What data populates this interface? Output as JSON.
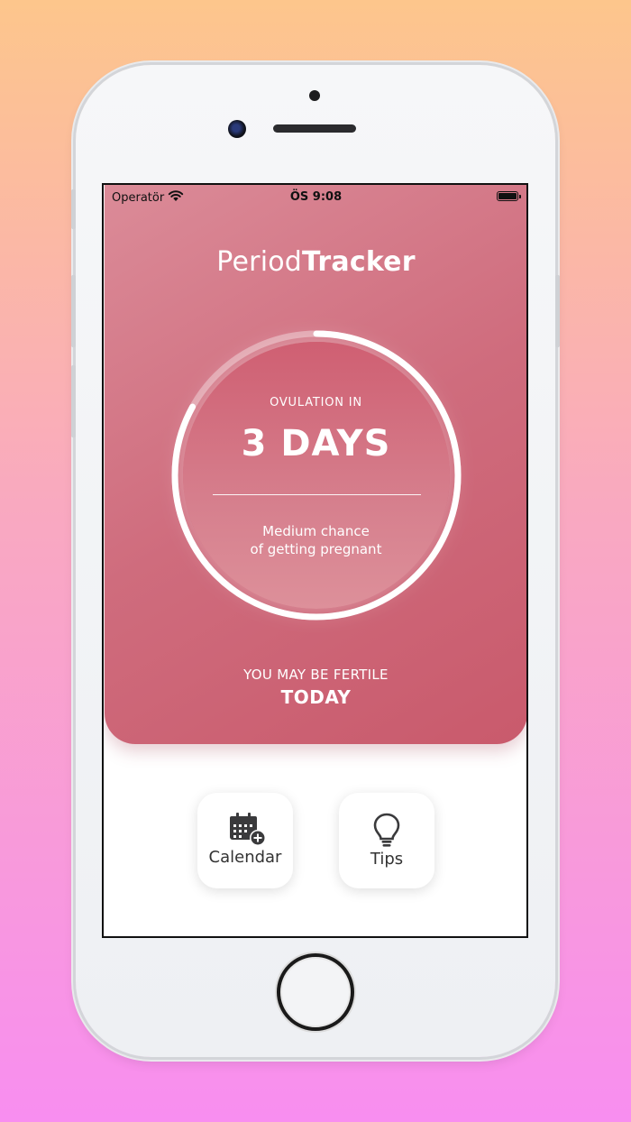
{
  "status_bar": {
    "carrier": "Operatör",
    "time": "ÖS 9:08"
  },
  "app": {
    "title_regular": "Period",
    "title_bold": "Tracker"
  },
  "ovulation": {
    "label": "OVULATION IN",
    "value": "3 DAYS",
    "chance_line1": "Medium chance",
    "chance_line2": "of getting pregnant",
    "cycle_progress": 0.83
  },
  "fertility": {
    "line1": "YOU MAY BE FERTILE",
    "line2": "TODAY"
  },
  "actions": {
    "calendar_label": "Calendar",
    "tips_label": "Tips"
  },
  "colors": {
    "card_start": "#db8b98",
    "card_end": "#c95a6c",
    "ring": "#ffffff"
  },
  "icons": {
    "calendar": "calendar-add-icon",
    "tips": "lightbulb-icon",
    "wifi": "wifi-icon",
    "battery": "battery-icon"
  }
}
